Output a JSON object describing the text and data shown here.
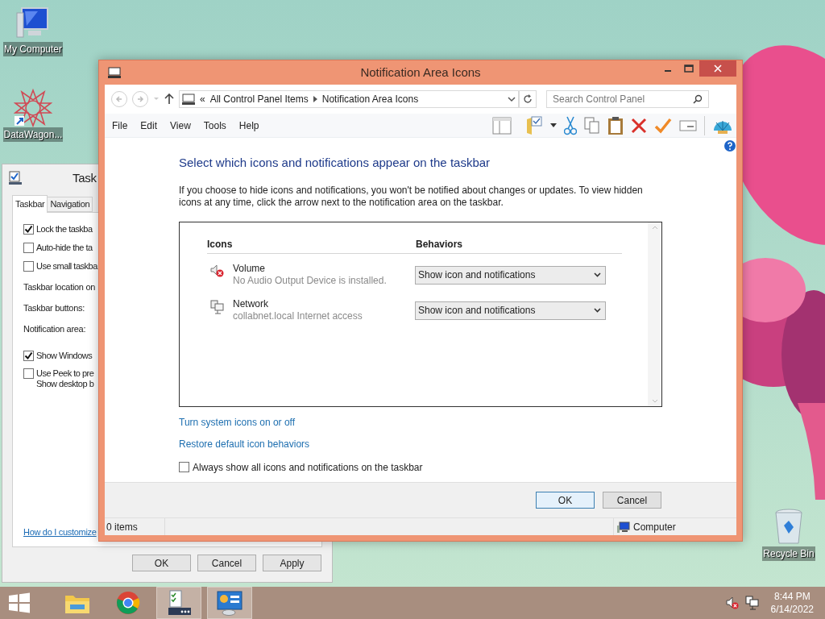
{
  "desktop_icons": [
    {
      "kind": "computer",
      "label": "My Computer"
    },
    {
      "kind": "datawagon",
      "label": "DataWagon..."
    },
    {
      "kind": "recycle",
      "label": "Recycle Bin"
    }
  ],
  "taskbar_properties": {
    "title": "Task",
    "tabs": [
      {
        "label": "Taskbar",
        "selected": true
      },
      {
        "label": "Navigation",
        "selected": false
      }
    ],
    "options": [
      {
        "kind": "checkbox",
        "label": "Lock the taskba",
        "checked": true
      },
      {
        "kind": "checkbox",
        "label": "Auto-hide the ta",
        "checked": false
      },
      {
        "kind": "checkbox",
        "label": "Use small taskba",
        "checked": false
      },
      {
        "kind": "label",
        "label": "Taskbar location on"
      },
      {
        "kind": "label",
        "label": "Taskbar buttons:"
      },
      {
        "kind": "label",
        "label": "Notification area:"
      },
      {
        "kind": "checkbox",
        "label": "Show Windows",
        "checked": true
      },
      {
        "kind": "checkbox",
        "label": "Use Peek to pre\nShow desktop b",
        "checked": false
      }
    ],
    "help_link": "How do I customize",
    "buttons": [
      "OK",
      "Cancel",
      "Apply"
    ]
  },
  "window": {
    "title": "Notification Area Icons",
    "breadcrumb": [
      "«",
      "All Control Panel Items",
      "Notification Area Icons"
    ],
    "search": {
      "placeholder": "Search Control Panel"
    },
    "menu": [
      "File",
      "Edit",
      "View",
      "Tools",
      "Help"
    ],
    "heading": "Select which icons and notifications appear on the taskbar",
    "description": "If you choose to hide icons and notifications, you won't be notified about changes or updates. To view hidden icons at any time, click the arrow next to the notification area on the taskbar.",
    "columns": [
      "Icons",
      "Behaviors"
    ],
    "rows": [
      {
        "kind": "volume",
        "name": "Volume",
        "detail": "No Audio Output Device is installed.",
        "behavior": "Show icon and notifications"
      },
      {
        "kind": "network",
        "name": "Network",
        "detail": "collabnet.local Internet access",
        "behavior": "Show icon and notifications"
      }
    ],
    "links": [
      "Turn system icons on or off",
      "Restore default icon behaviors"
    ],
    "always_show": {
      "label": "Always show all icons and notifications on the taskbar",
      "checked": false
    },
    "buttons": [
      {
        "label": "OK",
        "default": true
      },
      {
        "label": "Cancel",
        "default": false
      }
    ],
    "status_bar": {
      "items": "0 items",
      "location": "Computer"
    }
  },
  "taskbar": {
    "apps": [
      {
        "kind": "explorer",
        "open": false
      },
      {
        "kind": "chrome",
        "open": false
      },
      {
        "kind": "checklist",
        "open": true
      },
      {
        "kind": "control-panel",
        "open": true
      }
    ],
    "time": "8:44 PM",
    "date": "6/14/2022"
  }
}
